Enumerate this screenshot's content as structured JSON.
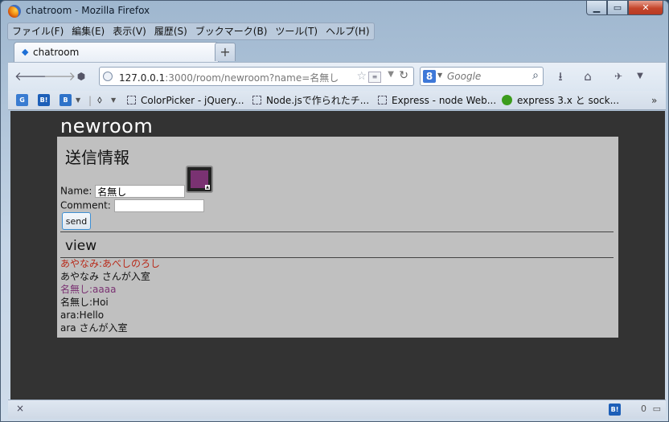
{
  "window": {
    "title": "chatroom - Mozilla Firefox"
  },
  "menu": [
    {
      "label": "ファイル(F)"
    },
    {
      "label": "編集(E)"
    },
    {
      "label": "表示(V)"
    },
    {
      "label": "履歴(S)"
    },
    {
      "label": "ブックマーク(B)"
    },
    {
      "label": "ツール(T)"
    },
    {
      "label": "ヘルプ(H)"
    }
  ],
  "tab": {
    "label": "chatroom",
    "newtab": "+"
  },
  "address": {
    "host": "127.0.0.1",
    "path": ":3000/room/newroom?name=名無し"
  },
  "search": {
    "placeholder": "Google",
    "engine_letter": "8"
  },
  "bookmarks": [
    {
      "label": "ColorPicker - jQuery..."
    },
    {
      "label": "Node.jsで作られたチ..."
    },
    {
      "label": "Express - node Web..."
    },
    {
      "label": "express 3.x と sock..."
    }
  ],
  "bookmark_icons": {
    "b1": "G",
    "b2": "B!",
    "b3": "B"
  },
  "page": {
    "room_title": "newroom",
    "send_section": "送信情報",
    "name_label": "Name:",
    "name_value": "名無し",
    "comment_label": "Comment:",
    "comment_value": "",
    "send_button": "send",
    "view_section": "view",
    "selected_color": "#7a3272",
    "log": [
      {
        "text": "あやなみ:あべしのろし",
        "color": "#b82a1a"
      },
      {
        "text": "あやなみ さんが入室",
        "color": "#111111"
      },
      {
        "text": "名無し:aaaa",
        "color": "#7a3272"
      },
      {
        "text": "名無し:Hoi",
        "color": "#111111"
      },
      {
        "text": "ara:Hello",
        "color": "#111111"
      },
      {
        "text": "ara さんが入室",
        "color": "#111111"
      }
    ]
  },
  "status": {
    "close": "×",
    "hatena": "B!",
    "count": "0"
  }
}
